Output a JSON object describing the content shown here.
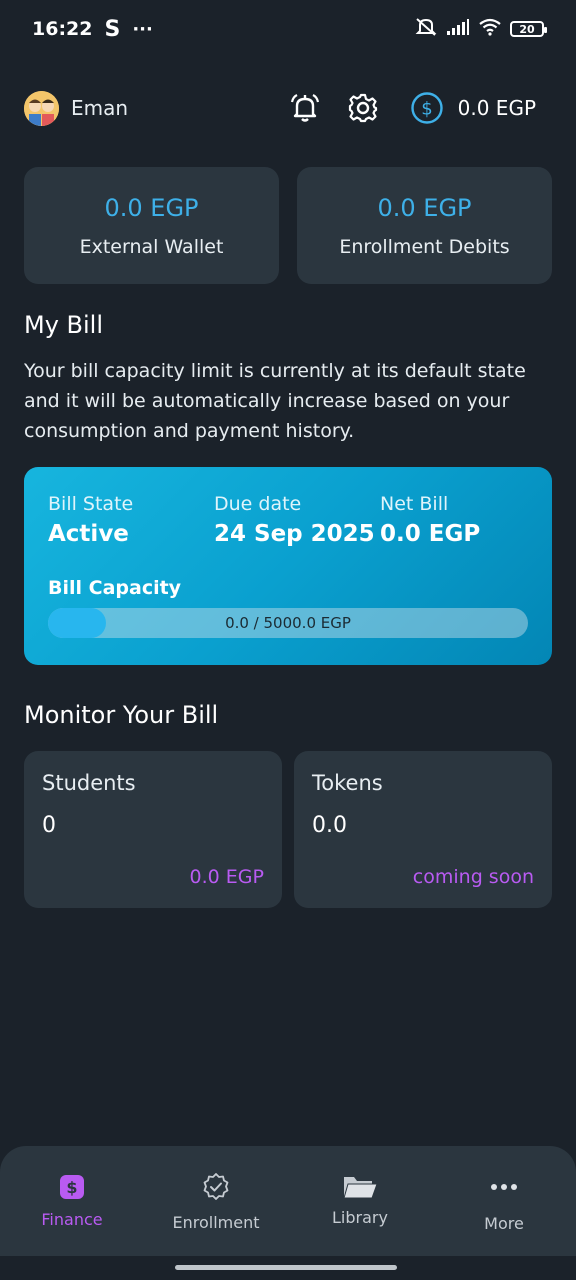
{
  "status_bar": {
    "time": "16:22",
    "carrier_glyph": "S",
    "more": "···",
    "battery": "20"
  },
  "header": {
    "user_name": "Eman",
    "balance": "0.0 EGP"
  },
  "wallets": [
    {
      "amount": "0.0 EGP",
      "label": "External Wallet"
    },
    {
      "amount": "0.0 EGP",
      "label": "Enrollment Debits"
    }
  ],
  "my_bill": {
    "title": "My Bill",
    "description": "Your bill capacity limit is currently at its default state and it will be automatically increase based on your consumption and payment history.",
    "state_label": "Bill State",
    "state_value": "Active",
    "due_label": "Due date",
    "due_value": "24 Sep 2025",
    "net_label": "Net Bill",
    "net_value": "0.0 EGP",
    "capacity_label": "Bill Capacity",
    "capacity_text": "0.0 / 5000.0 EGP",
    "capacity_fraction": 0.0
  },
  "monitor": {
    "title": "Monitor Your Bill",
    "cards": [
      {
        "label": "Students",
        "value": "0",
        "footer": "0.0 EGP"
      },
      {
        "label": "Tokens",
        "value": "0.0",
        "footer": "coming soon"
      }
    ]
  },
  "nav": [
    {
      "label": "Finance",
      "icon": "dollar-icon",
      "active": true
    },
    {
      "label": "Enrollment",
      "icon": "badge-check-icon",
      "active": false
    },
    {
      "label": "Library",
      "icon": "folder-open-icon",
      "active": false
    },
    {
      "label": "More",
      "icon": "more-icon",
      "active": false
    }
  ],
  "colors": {
    "background": "#1b222a",
    "card": "#2b363f",
    "accent_blue": "#3eb0e8",
    "accent_purple": "#b95bf2"
  }
}
